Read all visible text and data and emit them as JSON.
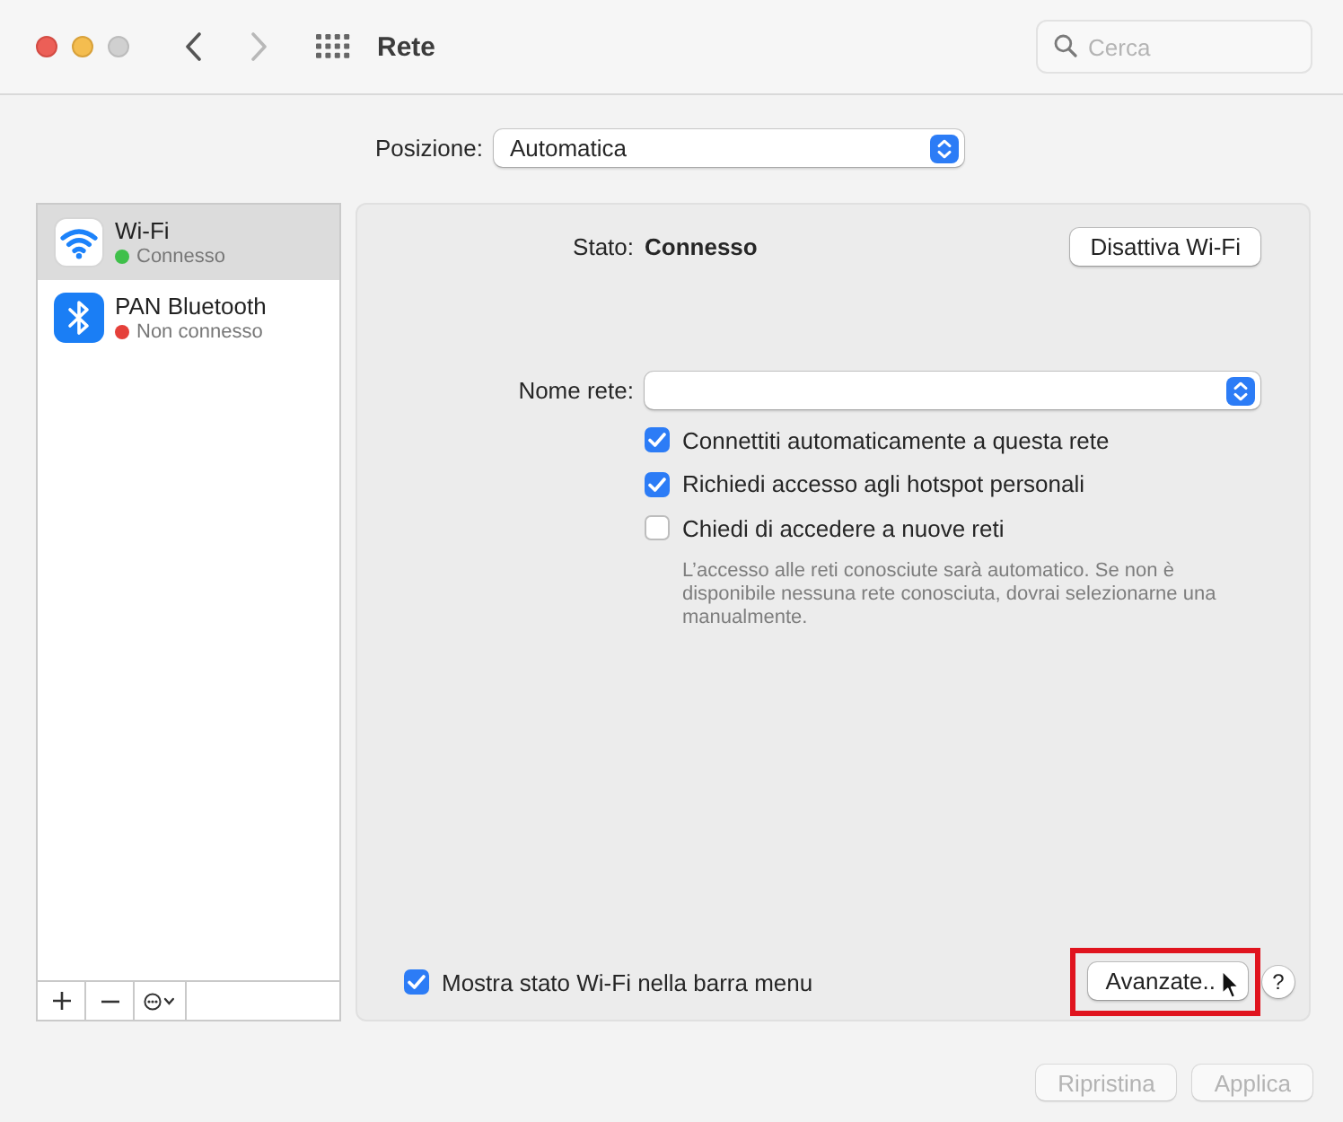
{
  "window": {
    "title": "Rete",
    "search": {
      "placeholder": "Cerca"
    },
    "navigation": {
      "back": {
        "disabled": false
      },
      "forward": {
        "disabled": true
      }
    }
  },
  "location": {
    "label": "Posizione:",
    "value": "Automatica"
  },
  "services": [
    {
      "kind": "wifi",
      "name": "Wi-Fi",
      "status": "Connesso",
      "color": "#3fc04a",
      "selected": true
    },
    {
      "kind": "bluetooth",
      "name": "PAN Bluetooth",
      "status": "Non connesso",
      "color": "#e5403a",
      "selected": false
    }
  ],
  "detail": {
    "status_label": "Stato:",
    "status_value": "Connesso",
    "toggle_button": "Disattiva Wi-Fi",
    "network_label": "Nome rete:",
    "options": [
      {
        "label": "Connettiti automaticamente a questa rete",
        "checked": true
      },
      {
        "label": "Richiedi accesso agli hotspot personali",
        "checked": true
      },
      {
        "label": "Chiedi di accedere a nuove reti",
        "checked": false
      }
    ],
    "note": "L’accesso alle reti conosciute sarà automatico. Se non è disponibile nessuna rete conosciuta, dovrai selezionarne una manualmente.",
    "menu_bar_option": {
      "label": "Mostra stato Wi-Fi nella barra menu",
      "checked": true
    },
    "advanced_button": "Avanzate..",
    "help_button": "?"
  },
  "footer": {
    "buttons": [
      {
        "label": "Ripristina",
        "disabled": true
      },
      {
        "label": "Applica",
        "disabled": true
      }
    ]
  }
}
